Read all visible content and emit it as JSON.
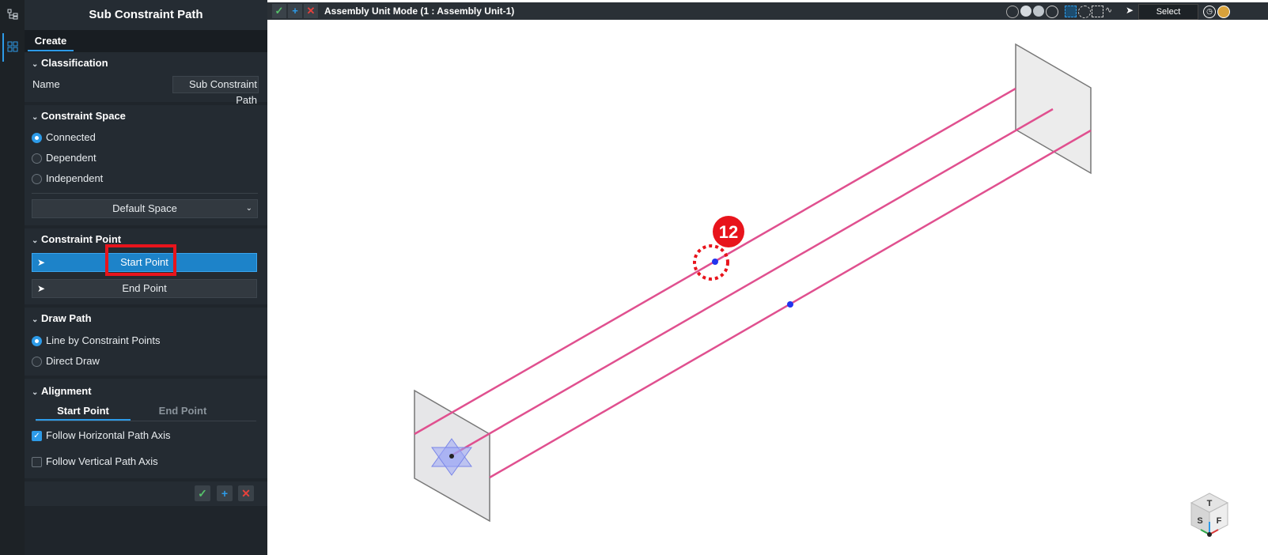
{
  "rail": {
    "icons": [
      "tree-icon",
      "layout-icon"
    ]
  },
  "panel": {
    "title": "Sub Constraint Path",
    "tab": "Create",
    "classification": {
      "header": "Classification",
      "name_label": "Name",
      "name_value": "Sub Constraint Path"
    },
    "constraint_space": {
      "header": "Constraint Space",
      "options": [
        "Connected",
        "Dependent",
        "Independent"
      ],
      "selected": "Connected",
      "dropdown": "Default Space"
    },
    "constraint_point": {
      "header": "Constraint Point",
      "start_label": "Start Point",
      "end_label": "End Point"
    },
    "draw_path": {
      "header": "Draw Path",
      "options": [
        "Line by Constraint Points",
        "Direct Draw"
      ],
      "selected": "Line by Constraint Points"
    },
    "alignment": {
      "header": "Alignment",
      "tabs": [
        "Start Point",
        "End Point"
      ],
      "active_tab": "Start Point",
      "checks": [
        {
          "label": "Follow Horizontal Path Axis",
          "checked": true
        },
        {
          "label": "Follow Vertical Path Axis",
          "checked": false
        }
      ]
    }
  },
  "viewport": {
    "mode_title": "Assembly Unit Mode (1 : Assembly Unit-1)",
    "select_label": "Select",
    "badge_number": "12",
    "viewcube_letters": {
      "top": "T",
      "side": "S",
      "front": "F"
    }
  },
  "colors": {
    "accent": "#2d9be8",
    "path": "#e0508f",
    "badge": "#e8141c",
    "highlight": "#e8141c"
  }
}
